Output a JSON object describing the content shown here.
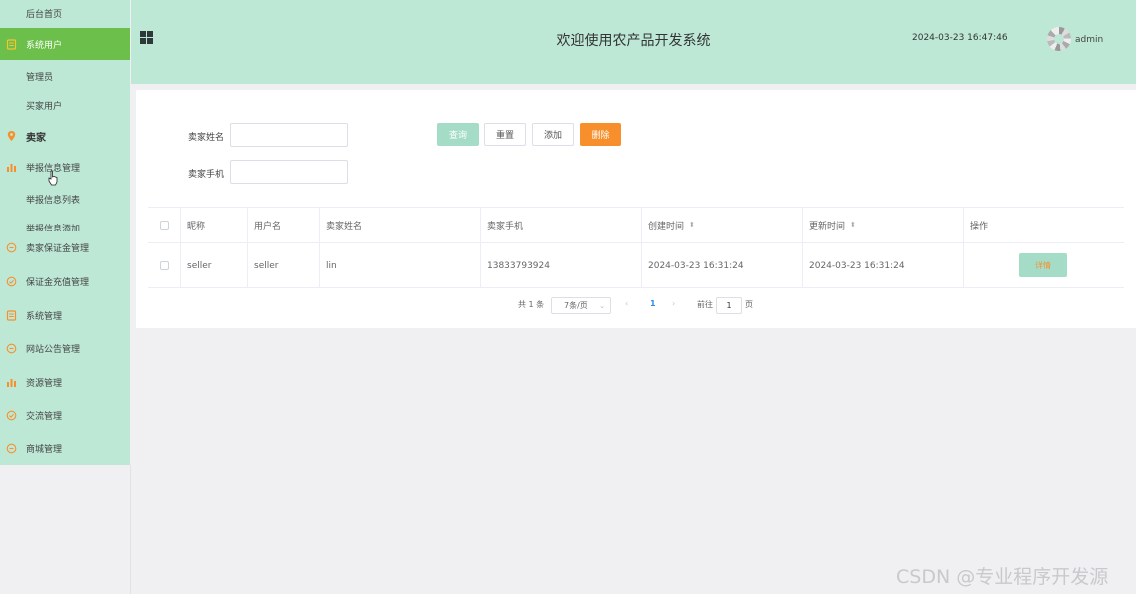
{
  "sidebar": {
    "items": [
      {
        "label": "后台首页",
        "icon": "none"
      },
      {
        "label": "系统用户",
        "icon": "document-icon",
        "active": true
      },
      {
        "label": "管理员",
        "icon": "none"
      },
      {
        "label": "买家用户",
        "icon": "none"
      },
      {
        "label": "卖家",
        "icon": "location-pin-icon",
        "bold": true
      },
      {
        "label": "举报信息管理",
        "icon": "bar-chart-icon"
      },
      {
        "label": "举报信息列表",
        "icon": "none"
      },
      {
        "label": "举报信息添加",
        "icon": "none"
      },
      {
        "label": "卖家保证金管理",
        "icon": "chat-icon"
      },
      {
        "label": "保证金充值管理",
        "icon": "check-circle-icon"
      },
      {
        "label": "系统管理",
        "icon": "document-icon"
      },
      {
        "label": "网站公告管理",
        "icon": "chat-icon"
      },
      {
        "label": "资源管理",
        "icon": "bar-chart-icon"
      },
      {
        "label": "交流管理",
        "icon": "check-circle-icon"
      },
      {
        "label": "商城管理",
        "icon": "chat-icon"
      }
    ],
    "accent": "#f7902c"
  },
  "header": {
    "title": "欢迎使用农产品开发系统",
    "datetime": "2024-03-23 16:47:46",
    "username": "admin"
  },
  "search": {
    "seller_name_label": "卖家姓名",
    "seller_phone_label": "卖家手机",
    "seller_name_value": "",
    "seller_phone_value": "",
    "btn_query": "查询",
    "btn_reset": "重置",
    "btn_add": "添加",
    "btn_delete": "删除"
  },
  "table": {
    "headers": [
      "昵称",
      "用户名",
      "卖家姓名",
      "卖家手机",
      "创建时间",
      "更新时间",
      "操作"
    ],
    "rows": [
      {
        "nickname": "seller",
        "username": "seller",
        "name": "lin",
        "phone": "13833793924",
        "created": "2024-03-23 16:31:24",
        "updated": "2024-03-23 16:31:24",
        "action": "详情"
      }
    ]
  },
  "pager": {
    "total": "共 1 条",
    "page_size": "7条/页",
    "current": "1",
    "goto_label": "前往",
    "goto_value": "1",
    "page_unit": "页"
  },
  "watermark": "CSDN @专业程序开发源",
  "colors": {
    "header_bg": "#bde8d6",
    "active_bg": "#6cbf4a",
    "primary_btn": "#a5dcc7",
    "danger_btn": "#f7902c"
  }
}
